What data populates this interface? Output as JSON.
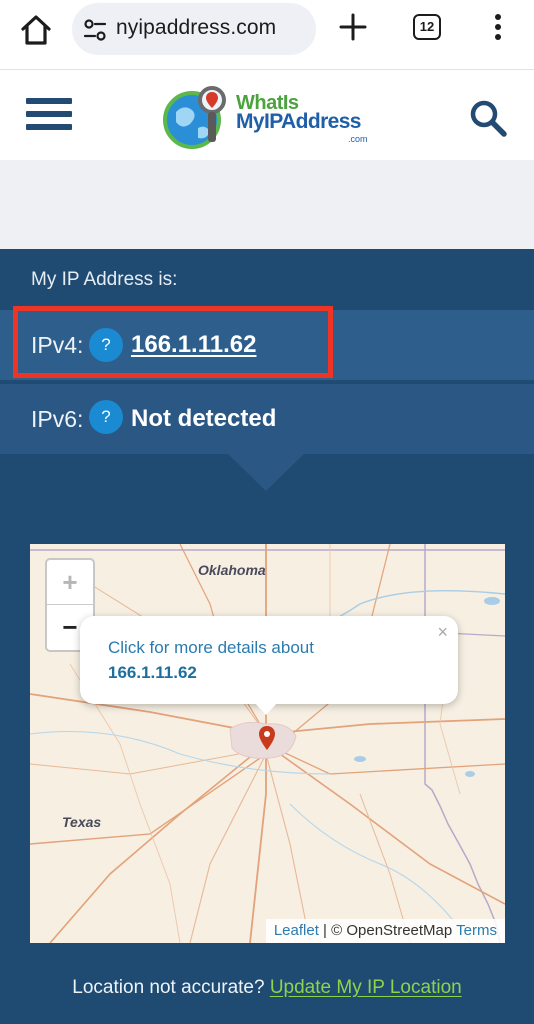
{
  "browser": {
    "url": "nyipaddress.com",
    "tab_count": "12"
  },
  "site": {
    "logo": {
      "line1": "WhatIs",
      "line2": "MyIPAddress",
      "line3": ".com"
    }
  },
  "ip_panel": {
    "heading": "My IP Address is:",
    "ipv4_label": "IPv4:",
    "ipv4_value": "166.1.11.62",
    "ipv6_label": "IPv6:",
    "ipv6_value": "Not detected",
    "help_glyph": "?"
  },
  "map": {
    "zoom_in": "+",
    "zoom_out": "−",
    "state_labels": [
      "Oklahoma",
      "Texas"
    ],
    "popup": {
      "line1": "Click for more details about",
      "line2": "166.1.11.62",
      "close": "×"
    },
    "attribution": {
      "leaflet": "Leaflet",
      "separator": "| ©",
      "osm": "OpenStreetMap",
      "terms": "Terms"
    }
  },
  "footer": {
    "text": "Location not accurate?",
    "link": "Update My IP Location"
  },
  "colors": {
    "panel_bg": "#1f4a72",
    "row_bg": "#2e5f8c",
    "highlight": "#ee3424",
    "help_badge": "#1a8ad2",
    "link_green": "#8fd34a",
    "map_link": "#2a7bb0"
  }
}
